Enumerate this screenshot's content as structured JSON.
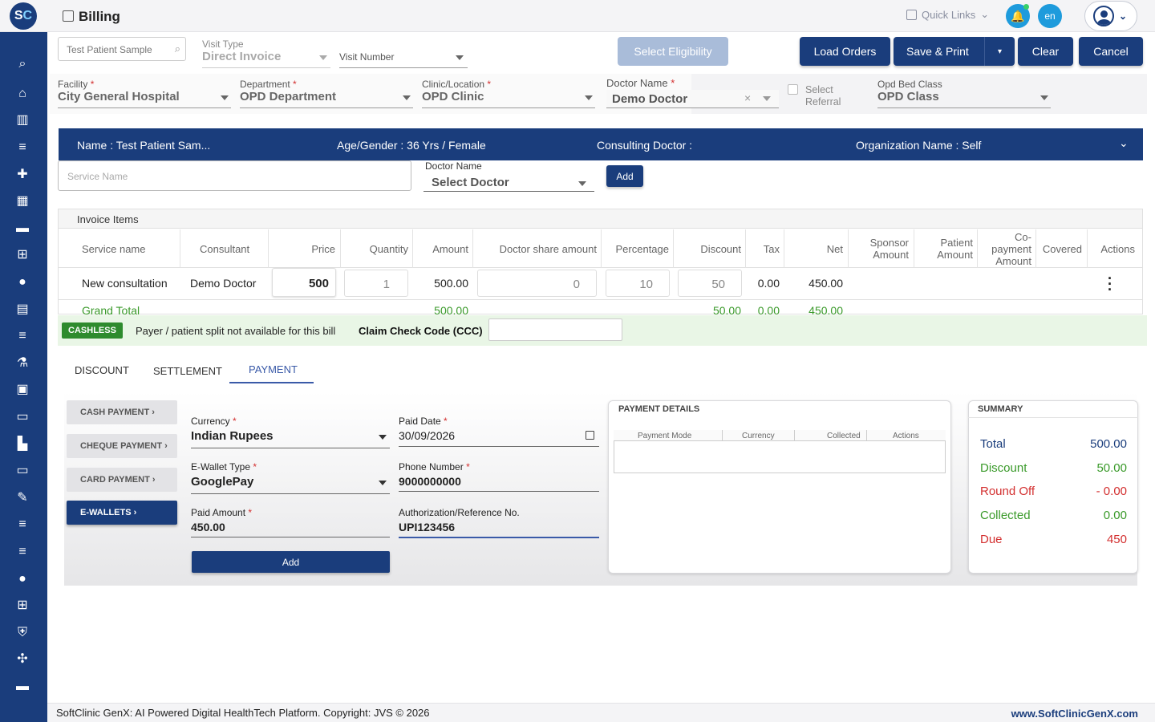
{
  "app": {
    "logo_s": "S",
    "logo_c": "C",
    "title": "Billing",
    "quick_links": "Quick Links",
    "lang": "en"
  },
  "sidebar": {
    "icons": [
      "search-icon",
      "home-icon",
      "bar-chart-icon",
      "menu-icon",
      "medical-bag-icon",
      "calendar-icon",
      "bed-icon",
      "plus-box-icon",
      "person-icon",
      "document-icon",
      "menu-icon",
      "lab-icon",
      "pharmacy-icon",
      "book-icon",
      "building-icon",
      "devices-icon",
      "wrench-icon",
      "menu-icon",
      "menu-icon",
      "blood-drop-icon",
      "add-box-icon",
      "shield-icon",
      "network-icon",
      "folder-icon"
    ]
  },
  "header": {
    "patient_search": "Test Patient Sample",
    "visit_type_label": "Visit Type",
    "visit_type_value": "Direct Invoice",
    "visit_number_label": "Visit Number",
    "select_eligibility": "Select Eligibility",
    "load_orders": "Load Orders",
    "save_print": "Save & Print",
    "clear": "Clear",
    "cancel": "Cancel"
  },
  "fields": {
    "facility_label": "Facility",
    "facility_value": "City General Hospital",
    "department_label": "Department",
    "department_value": "OPD Department",
    "clinic_label": "Clinic/Location",
    "clinic_value": "OPD Clinic",
    "doctor_label": "Doctor Name",
    "doctor_value": "Demo Doctor",
    "select_referral": "Select Referral",
    "bed_class_label": "Opd Bed Class",
    "bed_class_value": "OPD Class"
  },
  "banner": {
    "name": "Name :  Test Patient Sam...",
    "age_gender": "Age/Gender :  36 Yrs / Female",
    "consulting": "Consulting Doctor :",
    "organization": "Organization Name :  Self"
  },
  "service": {
    "placeholder": "Service Name",
    "doctor_label": "Doctor Name",
    "doctor_value": "Select Doctor",
    "add": "Add"
  },
  "invoice": {
    "title": "Invoice Items",
    "headers": [
      "Service name",
      "Consultant",
      "Price",
      "Quantity",
      "Amount",
      "Doctor share amount",
      "Percentage",
      "Discount",
      "Tax",
      "Net",
      "Sponsor Amount",
      "Patient Amount",
      "Co-payment Amount",
      "Covered",
      "Actions"
    ],
    "row": {
      "service": "New consultation",
      "consultant": "Demo Doctor",
      "price": "500",
      "quantity": "1",
      "amount": "500.00",
      "doctor_share": "0",
      "percentage": "10",
      "discount": "50",
      "tax": "0.00",
      "net": "450.00"
    },
    "grand_total": {
      "label": "Grand Total",
      "amount": "500.00",
      "discount": "50.00",
      "tax": "0.00",
      "net": "450.00"
    }
  },
  "cashless": {
    "badge": "CASHLESS",
    "note": "Payer / patient split not available for this bill",
    "ccc_label": "Claim Check Code (CCC)"
  },
  "tabs": [
    "DISCOUNT",
    "SETTLEMENT",
    "PAYMENT"
  ],
  "payment_methods": [
    "CASH PAYMENT ›",
    "CHEQUE PAYMENT ›",
    "CARD PAYMENT ›",
    "E-WALLETS ›"
  ],
  "payment_form": {
    "currency_label": "Currency",
    "currency_value": "Indian Rupees",
    "paid_date_label": "Paid Date",
    "paid_date_value": "30/09/2026",
    "wallet_label": "E-Wallet Type",
    "wallet_value": "GooglePay",
    "phone_label": "Phone Number",
    "phone_value": "9000000000",
    "paid_amount_label": "Paid Amount",
    "paid_amount_value": "450.00",
    "auth_label": "Authorization/Reference No.",
    "auth_value": "UPI123456",
    "add": "Add"
  },
  "payment_details": {
    "title": "PAYMENT DETAILS",
    "headers": [
      "Payment Mode",
      "Currency",
      "Collected",
      "Actions"
    ]
  },
  "summary": {
    "title": "SUMMARY",
    "rows": [
      {
        "label": "Total",
        "value": "500.00"
      },
      {
        "label": "Discount",
        "value": "50.00"
      },
      {
        "label": "Round Off",
        "value": "- 0.00"
      },
      {
        "label": "Collected",
        "value": "0.00"
      },
      {
        "label": "Due",
        "value": "450"
      }
    ]
  },
  "footer": {
    "copyright": "SoftClinic GenX: AI Powered Digital HealthTech Platform. Copyright: JVS © 2026",
    "website": "www.SoftClinicGenX.com"
  },
  "colors": {
    "primary": "#1a3d7c",
    "accent": "#1e9bdc",
    "green": "#3a9a2a",
    "red": "#d32f2f",
    "eligibility": "#a9bcd9"
  }
}
